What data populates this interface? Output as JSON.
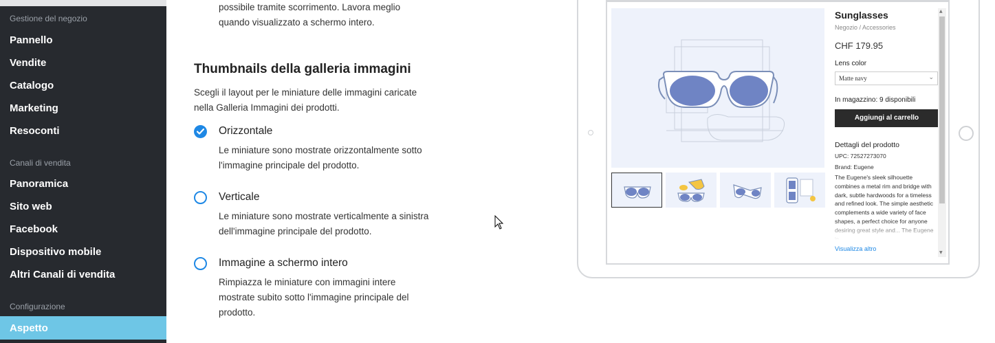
{
  "sidebar": {
    "sections": [
      {
        "title": "Gestione del negozio",
        "items": [
          "Pannello",
          "Vendite",
          "Catalogo",
          "Marketing",
          "Resoconti"
        ]
      },
      {
        "title": "Canali di vendita",
        "items": [
          "Panoramica",
          "Sito web",
          "Facebook",
          "Dispositivo mobile",
          "Altri Canali di vendita"
        ]
      },
      {
        "title": "Configurazione",
        "items": [
          "Aspetto"
        ]
      }
    ],
    "active_item": "Aspetto",
    "active_color": "#6ec6e6"
  },
  "main": {
    "intro_text": [
      "possibile tramite scorrimento. Lavora meglio",
      "quando visualizzato a schermo intero."
    ],
    "section_title": "Thumbnails della galleria immagini",
    "section_desc": [
      "Scegli il layout per le miniature delle immagini caricate",
      "nella Galleria Immagini dei prodotti."
    ],
    "options": [
      {
        "label": "Orizzontale",
        "desc": [
          "Le miniature sono mostrate orizzontalmente sotto",
          "l'immagine principale del prodotto."
        ],
        "selected": true
      },
      {
        "label": "Verticale",
        "desc": [
          "Le miniature sono mostrate verticalmente a sinistra",
          "dell'immagine principale del prodotto."
        ],
        "selected": false
      },
      {
        "label": "Immagine a schermo intero",
        "desc": [
          "Rimpiazza le miniature con immagini intere",
          "mostrate subito sotto l'immagine principale del",
          "prodotto."
        ],
        "selected": false
      }
    ],
    "accent_color": "#1e88e5"
  },
  "preview": {
    "product_title": "Sunglasses",
    "breadcrumb": "Negozio  /  Accessories",
    "price": "CHF 179.95",
    "lens_label": "Lens color",
    "lens_value": "Matte navy",
    "stock": "In magazzino: 9 disponibili",
    "cart_button": "Aggiungi al carrello",
    "details_title": "Dettagli del prodotto",
    "upc": "UPC: 72527273070",
    "brand": "Brand: Eugene",
    "description": "The Eugene's sleek silhouette combines a metal rim and bridge with dark, subtle hardwoods for a timeless and refined look. The simple aesthetic complements a wide variety of face shapes, a perfect choice for anyone desiring great style and... The Eugene is",
    "more_link": "Visualizza altro",
    "icons": [
      "sunglasses-icon",
      "chevron-down-icon",
      "checkmark-icon",
      "cursor-icon"
    ]
  }
}
